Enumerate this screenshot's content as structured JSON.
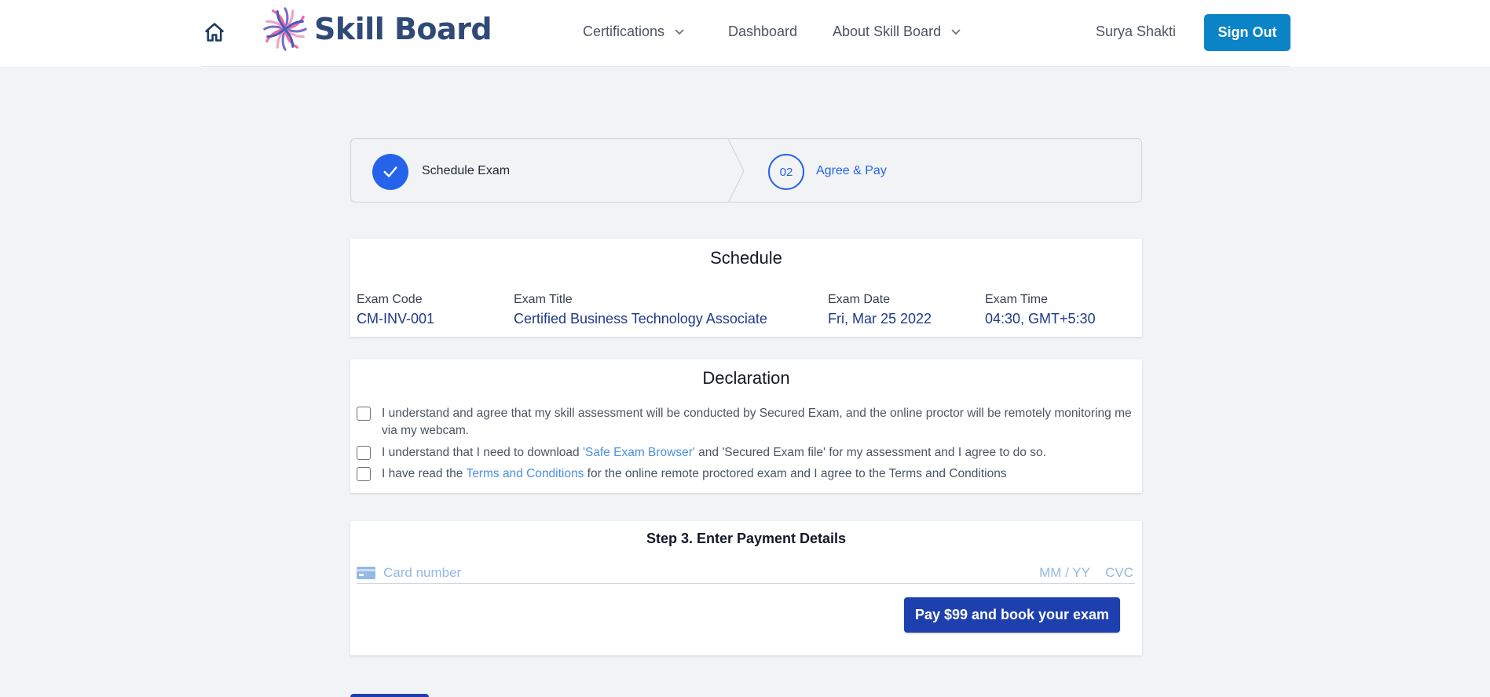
{
  "header": {
    "logo_text": "Skill Board",
    "nav": [
      {
        "label": "Certifications",
        "has_dropdown": true
      },
      {
        "label": "Dashboard",
        "has_dropdown": false
      },
      {
        "label": "About Skill Board",
        "has_dropdown": true
      }
    ],
    "user_name": "Surya Shakti",
    "signout_label": "Sign Out"
  },
  "stepper": {
    "step1_label": "Schedule Exam",
    "step1_state": "complete",
    "step2_number": "02",
    "step2_label": "Agree & Pay",
    "step2_state": "current"
  },
  "schedule": {
    "title": "Schedule",
    "columns": [
      {
        "label": "Exam Code",
        "value": "CM-INV-001"
      },
      {
        "label": "Exam Title",
        "value": "Certified Business Technology Associate"
      },
      {
        "label": "Exam Date",
        "value": "Fri, Mar 25 2022"
      },
      {
        "label": "Exam Time",
        "value": "04:30, GMT+5:30"
      }
    ]
  },
  "declaration": {
    "title": "Declaration",
    "items": [
      {
        "text": "I understand and agree that my skill assessment will be conducted by Secured Exam, and the online proctor will be remotely monitoring me via my webcam.",
        "checked": false
      },
      {
        "pre": "I understand that I need to download ",
        "link": "'Safe Exam Browser'",
        "post": " and 'Secured Exam file' for my assessment and I agree to do so.",
        "checked": false
      },
      {
        "pre": "I have read the ",
        "link": "Terms and Conditions",
        "post": " for the online remote proctored exam and I agree to the Terms and Conditions",
        "checked": false
      }
    ]
  },
  "payment": {
    "title": "Step 3. Enter Payment Details",
    "card_placeholder": "Card number",
    "expiry_placeholder": "MM / YY",
    "cvc_placeholder": "CVC",
    "pay_button_label": "Pay $99 and book your exam"
  },
  "colors": {
    "primary": "#2563eb",
    "signout": "#0a84c6",
    "pay_button": "#1e40af",
    "link": "#4a90e2",
    "value_text": "#1e3a8a"
  }
}
